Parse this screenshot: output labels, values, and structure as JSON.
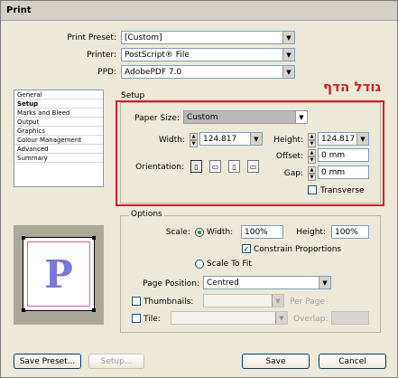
{
  "window": {
    "title": "Print"
  },
  "top": {
    "preset_label": "Print Preset:",
    "preset_value": "[Custom]",
    "printer_label": "Printer:",
    "printer_value": "PostScript® File",
    "ppd_label": "PPD:",
    "ppd_value": "AdobePDF 7.0"
  },
  "sidebar": {
    "items": [
      {
        "label": "General"
      },
      {
        "label": "Setup"
      },
      {
        "label": "Marks and Bleed"
      },
      {
        "label": "Output"
      },
      {
        "label": "Graphics"
      },
      {
        "label": "Colour Management"
      },
      {
        "label": "Advanced"
      },
      {
        "label": "Summary"
      }
    ]
  },
  "setup": {
    "heading": "Setup",
    "annotation": "גודל הדף",
    "paper_size_label": "Paper Size:",
    "paper_size_value": "Custom",
    "width_label": "Width:",
    "width_value": "124.817",
    "height_label": "Height:",
    "height_value": "124.817",
    "offset_label": "Offset:",
    "offset_value": "0 mm",
    "gap_label": "Gap:",
    "gap_value": "0 mm",
    "orientation_label": "Orientation:",
    "transverse_label": "Transverse"
  },
  "options": {
    "heading": "Options",
    "scale_label": "Scale:",
    "width_label": "Width:",
    "width_value": "100%",
    "height_label": "Height:",
    "height_value": "100%",
    "constrain_label": "Constrain Proportions",
    "scale_to_fit_label": "Scale To Fit",
    "page_position_label": "Page Position:",
    "page_position_value": "Centred",
    "thumbnails_label": "Thumbnails:",
    "per_page_label": "Per Page",
    "tile_label": "Tile:",
    "overlap_label": "Overlap:"
  },
  "preview": {
    "letter": "P"
  },
  "buttons": {
    "save_preset": "Save Preset...",
    "setup": "Setup...",
    "save": "Save",
    "cancel": "Cancel"
  }
}
